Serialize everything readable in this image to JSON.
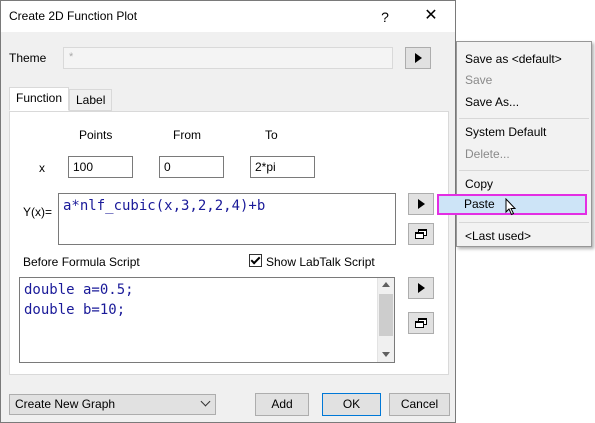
{
  "window": {
    "title": "Create 2D Function Plot",
    "help": "?",
    "close": "✕"
  },
  "theme": {
    "label": "Theme",
    "value": "*"
  },
  "tabs": [
    {
      "label": "Function"
    },
    {
      "label": "Label"
    }
  ],
  "function": {
    "headers": {
      "points": "Points",
      "from": "From",
      "to": "To"
    },
    "x_label": "x",
    "points_value": "100",
    "from_value": "0",
    "to_value": "2*pi",
    "y_label": "Y(x)=",
    "y_expression": "a*nlf_cubic(x,3,2,2,4)+b"
  },
  "script": {
    "label": "Before Formula Script",
    "show_labtalk": "Show LabTalk Script",
    "show_labtalk_checked": true,
    "lines": [
      "double a=0.5;",
      "double b=10;"
    ]
  },
  "footer": {
    "graph_select": "Create New Graph",
    "add": "Add",
    "ok": "OK",
    "cancel": "Cancel"
  },
  "context_menu": {
    "items": [
      {
        "label": "Save as <default>",
        "enabled": true
      },
      {
        "label": "Save",
        "enabled": false
      },
      {
        "label": "Save As...",
        "enabled": true
      },
      {
        "label": "System Default",
        "enabled": true
      },
      {
        "label": "Delete...",
        "enabled": false
      },
      {
        "label": "Copy",
        "enabled": true
      },
      {
        "label": "Paste",
        "enabled": true,
        "highlighted": true
      },
      {
        "label": "<Last used>",
        "enabled": true
      }
    ]
  },
  "colors": {
    "highlight_border": "#e32ee3",
    "highlight_fill": "#cde4f7",
    "code_text": "#1a1a99"
  }
}
